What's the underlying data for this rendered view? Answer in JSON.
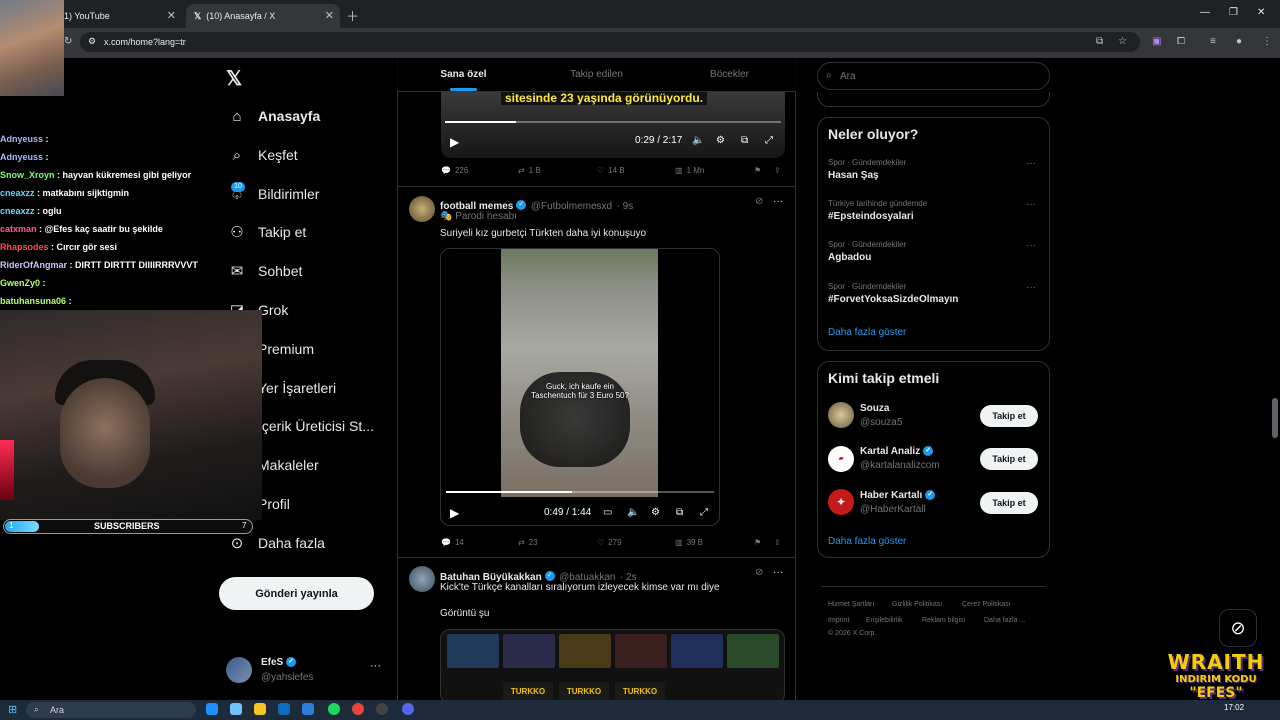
{
  "browser": {
    "tabs": [
      {
        "label": "1) YouTube"
      },
      {
        "label": "(10) Anasayfa / X"
      }
    ],
    "url": "x.com/home?lang=tr"
  },
  "nav": {
    "items": [
      {
        "icon": "home-icon",
        "label": "Anasayfa"
      },
      {
        "icon": "search-icon",
        "label": "Keşfet"
      },
      {
        "icon": "bell-icon",
        "label": "Bildirimler"
      },
      {
        "icon": "user-plus-icon",
        "label": "Takip et"
      },
      {
        "icon": "mail-icon",
        "label": "Sohbet"
      },
      {
        "icon": "grok-icon",
        "label": "Grok"
      },
      {
        "icon": "premium-icon",
        "label": "Premium"
      },
      {
        "icon": "bookmark-icon",
        "label": "Yer İşaretleri"
      },
      {
        "icon": "creator-icon",
        "label": "İçerik Üreticisi St..."
      },
      {
        "icon": "article-icon",
        "label": "Makaleler"
      },
      {
        "icon": "profile-icon",
        "label": "Profil"
      },
      {
        "icon": "more-icon",
        "label": "Daha fazla"
      }
    ],
    "notif_badge": "10",
    "post_button": "Gönderi yayınla",
    "account": {
      "name": "EfeS",
      "handle": "@yahslefes"
    }
  },
  "feed": {
    "tabs": [
      "Sana özel",
      "Takip edilen",
      "Böcekler"
    ],
    "post1": {
      "caption": "sitesinde 23 yaşında görünüyordu.",
      "time": "0:29 / 2:17",
      "progress": 0.21,
      "stats": {
        "replies": "226",
        "reposts": "1 B",
        "likes": "14 B",
        "views": "1 Mn"
      }
    },
    "post2": {
      "name": "football memes",
      "handle": "@Futbolmemesxd",
      "age": "· 9s",
      "label": "Parodi hesabı",
      "text": "Suriyeli kız gurbetçi Türkten daha iyi konuşuyo",
      "subtitle": "Guck, ich kaufe ein Taschentuch für 3 Euro 50?",
      "time": "0:49 / 1:44",
      "progress": 0.47,
      "stats": {
        "replies": "14",
        "reposts": "23",
        "likes": "279",
        "views": "39 B"
      }
    },
    "post3": {
      "name": "Batuhan Büyükakkan",
      "handle": "@batuakkan",
      "age": "· 2s",
      "text": "Kick'te Türkçe kanalları sıralıyorum izleyecek kimse var mı diye",
      "text2": "Görüntü şu",
      "thumb_labels": [
        "TURKKO",
        "TURKKO",
        "TURKKO"
      ]
    }
  },
  "right": {
    "search_placeholder": "Ara",
    "trends_title": "Neler oluyor?",
    "trends": [
      {
        "meta": "Spor · Gündemdekiler",
        "title": "Hasan Şaş"
      },
      {
        "meta": "Türkiye tarihinde gündemde",
        "title": "#Epsteindosyalari"
      },
      {
        "meta": "Spor · Gündemdekiler",
        "title": "Agbadou"
      },
      {
        "meta": "Spor · Gündemdekiler",
        "title": "#ForvetYoksaSizdeOlmayın"
      }
    ],
    "show_more": "Daha fazla göster",
    "wtf_title": "Kimi takip etmeli",
    "who_to_follow": [
      {
        "name": "Souza",
        "handle": "@souza5",
        "button": "Takip et"
      },
      {
        "name": "Kartal Analiz",
        "handle": "@kartalanalizcom",
        "button": "Takip et"
      },
      {
        "name": "Haber Kartalı",
        "handle": "@HaberKartall",
        "button": "Takip et"
      }
    ],
    "footer": [
      "Hizmet Şartları",
      "Gizlilik Politikası",
      "Çerez Politikası",
      "Imprint",
      "Erişilebilirlik",
      "Reklam bilgisi",
      "Daha fazla ...",
      "© 2026 X Corp."
    ]
  },
  "stream": {
    "chat": [
      {
        "user": "Adnyeuss",
        "msg": ":",
        "color": "#a8b8ff"
      },
      {
        "user": "Adnyeuss",
        "msg": ":",
        "color": "#a8b8ff"
      },
      {
        "user": "Snow_Xroyn",
        "msg": ": hayvan kükremesi gibi geliyor",
        "color": "#7cff7c"
      },
      {
        "user": "cneaxzz",
        "msg": ": matkabını sijktigmin",
        "color": "#6fd3ff"
      },
      {
        "user": "cneaxzz",
        "msg": ": oglu",
        "color": "#6fd3ff"
      },
      {
        "user": "catxman",
        "msg": ": @Efes kaç saatir bu şekilde",
        "color": "#ff5c8a"
      },
      {
        "user": "Rhapsodes",
        "msg": ": Cırcır gör sesi",
        "color": "#ff4d4d"
      },
      {
        "user": "RiderOfAngmar",
        "msg": ": DIRTT DIRTTT DIIIIRRRVVVT",
        "color": "#c8c8ff"
      },
      {
        "user": "GwenZy0",
        "msg": ":",
        "color": "#b4ff6e"
      },
      {
        "user": "batuhansuna06",
        "msg": ":",
        "color": "#b4ff6e"
      }
    ],
    "subs_label": "SUBSCRIBERS",
    "subs_current": "1",
    "subs_goal": "7",
    "subs_fraction": 0.14,
    "brand": [
      "WRAITH",
      "INDIRIM KODU",
      "\"EFES\""
    ]
  },
  "taskbar": {
    "search": "Ara",
    "clock": "17:02"
  }
}
